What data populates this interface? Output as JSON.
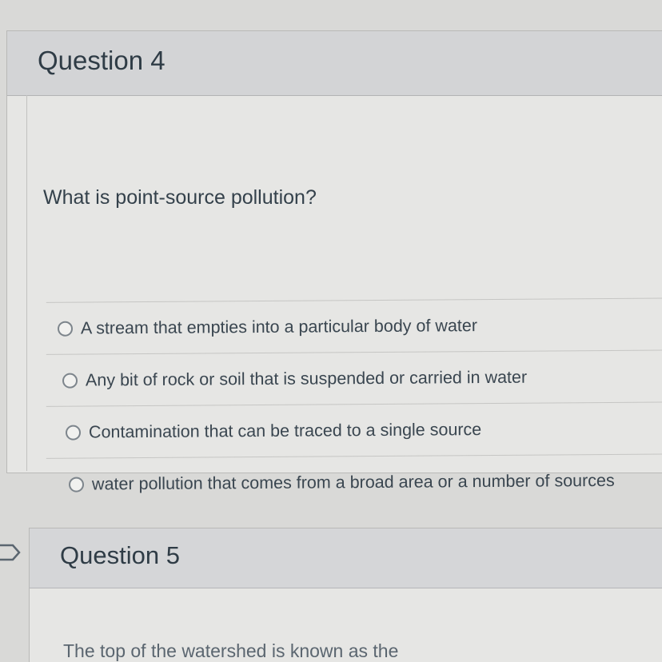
{
  "question4": {
    "title": "Question 4",
    "prompt": "What is point-source pollution?",
    "answers": [
      {
        "label": "A stream that empties into a particular body of water"
      },
      {
        "label": "Any bit of rock or soil that is suspended or carried in water"
      },
      {
        "label": "Contamination that can be traced to a single source"
      },
      {
        "label": "water pollution that comes from a broad area or a number of sources"
      }
    ]
  },
  "question5": {
    "title": "Question 5",
    "prompt_partial": "The top of the watershed is known as the"
  },
  "icons": {
    "question_marker": "flag-marker-icon",
    "radio": "radio-unselected-icon"
  },
  "colors": {
    "header_bg": "#d3d4d6",
    "card_bg": "#e6e6e4",
    "text": "#2d3b45"
  }
}
